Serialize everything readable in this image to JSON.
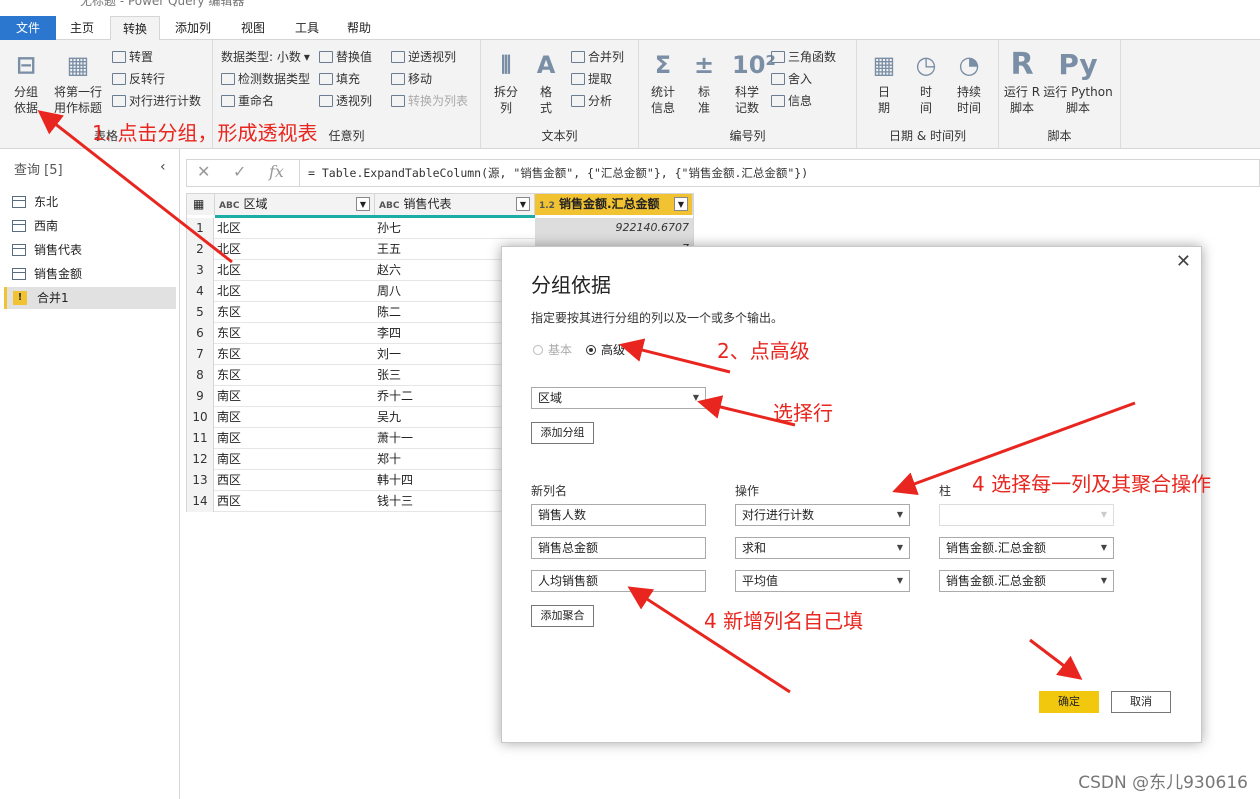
{
  "window": {
    "title": "无标题 - Power Query 编辑器"
  },
  "tabs": [
    "文件",
    "主页",
    "转换",
    "添加列",
    "视图",
    "工具",
    "帮助"
  ],
  "ribbon": {
    "table_group": {
      "label": "表格",
      "group_by": "分组\n依据",
      "first_row": "将第一行\n用作标题",
      "transpose": "转置",
      "reverse_rows": "反转行",
      "count_rows": "对行进行计数"
    },
    "any_column": {
      "label": "任意列",
      "data_type": "数据类型: 小数",
      "detect_type": "检测数据类型",
      "rename": "重命名",
      "replace": "替换值",
      "fill": "填充",
      "pivot": "透视列",
      "unpivot": "逆透视列",
      "move": "移动",
      "to_list": "转换为列表"
    },
    "text_column": {
      "label": "文本列",
      "split": "拆分\n列",
      "format": "格\n式",
      "merge": "合并列",
      "extract": "提取",
      "parse": "分析"
    },
    "number_column": {
      "label": "编号列",
      "stats": "统计\n信息",
      "standard": "标\n准",
      "scientific": "科学\n记数",
      "trig": "三角函数",
      "rounding": "舍入",
      "info": "信息"
    },
    "datetime_column": {
      "label": "日期 & 时间列",
      "date": "日\n期",
      "time": "时\n间",
      "duration": "持续\n时间"
    },
    "scripts": {
      "label": "脚本",
      "r": "运行 R\n脚本",
      "python": "运行 Python\n脚本"
    }
  },
  "queries": {
    "header": "查询 [5]",
    "items": [
      "东北",
      "西南",
      "销售代表",
      "销售金额",
      "合并1"
    ]
  },
  "formula": {
    "text": "= Table.ExpandTableColumn(源, \"销售金额\", {\"汇总金额\"}, {\"销售金额.汇总金额\"})"
  },
  "grid": {
    "columns": [
      "区域",
      "销售代表",
      "销售金额.汇总金额"
    ],
    "types": [
      "ABC",
      "ABC",
      "1.2"
    ],
    "rows": [
      [
        "1",
        "北区",
        "孙七",
        "922140.6707"
      ],
      [
        "2",
        "北区",
        "王五",
        "7"
      ],
      [
        "3",
        "北区",
        "赵六",
        ""
      ],
      [
        "4",
        "北区",
        "周八",
        ""
      ],
      [
        "5",
        "东区",
        "陈二",
        ""
      ],
      [
        "6",
        "东区",
        "李四",
        ""
      ],
      [
        "7",
        "东区",
        "刘一",
        ""
      ],
      [
        "8",
        "东区",
        "张三",
        ""
      ],
      [
        "9",
        "南区",
        "乔十二",
        ""
      ],
      [
        "10",
        "南区",
        "吴九",
        ""
      ],
      [
        "11",
        "南区",
        "萧十一",
        ""
      ],
      [
        "12",
        "南区",
        "郑十",
        ""
      ],
      [
        "13",
        "西区",
        "韩十四",
        ""
      ],
      [
        "14",
        "西区",
        "钱十三",
        ""
      ]
    ]
  },
  "dialog": {
    "title": "分组依据",
    "desc": "指定要按其进行分组的列以及一个或多个输出。",
    "basic": "基本",
    "advanced": "高级",
    "group_col": "区域",
    "add_group": "添加分组",
    "col_newname": "新列名",
    "col_op": "操作",
    "col_col": "柱",
    "aggs": [
      {
        "name": "销售人数",
        "op": "对行进行计数",
        "col": ""
      },
      {
        "name": "销售总金额",
        "op": "求和",
        "col": "销售金额.汇总金额"
      },
      {
        "name": "人均销售额",
        "op": "平均值",
        "col": "销售金额.汇总金额"
      }
    ],
    "add_agg": "添加聚合",
    "ok": "确定",
    "cancel": "取消"
  },
  "annotations": {
    "a1": "1. 点击分组，形成透视表",
    "a2": "2、点高级",
    "a3": "选择行",
    "a4": "4 选择每一列及其聚合操作",
    "a5": "4 新增列名自己填",
    "color": "#e8261f"
  },
  "watermark": "CSDN @东儿930616"
}
